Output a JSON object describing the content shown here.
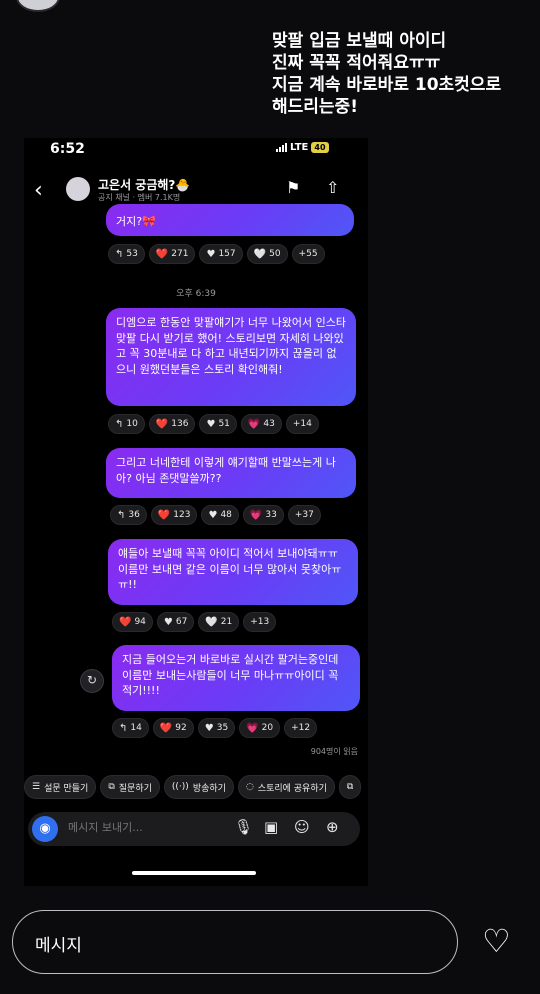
{
  "caption": {
    "lines": [
      "맞팔 입금 보낼때 아이디",
      "진짜 꼭꼭 적어줘요ㅠㅠ",
      "지금 계속 바로바로 10초컷으로",
      "해드리는중!"
    ]
  },
  "status": {
    "time": "6:52",
    "network": "LTE",
    "battery": "40"
  },
  "channel": {
    "title": "고은서 궁금해?🐣",
    "subtitle": "공지 채널 · 멤버 7.1K명"
  },
  "messages": [
    {
      "text": "거지?🎀",
      "reactions": [
        {
          "icon": "↰",
          "count": "53"
        },
        {
          "icon": "❤️",
          "count": "271"
        },
        {
          "icon": "♥",
          "count": "157"
        },
        {
          "icon": "🤍",
          "count": "50"
        },
        {
          "icon": "",
          "count": "+55"
        }
      ]
    },
    {
      "text": "디엠으로 한동안 맞팔얘기가 너무 나왔어서 인스타 맞팔 다시 받기로 했어! 스토리보면 자세히 나와있고 꼭 30분내로 다 하고 내년되기까지 끊을리 없으니 원했던분들은 스토리 확인해줘!",
      "reactions": [
        {
          "icon": "↰",
          "count": "10"
        },
        {
          "icon": "❤️",
          "count": "136"
        },
        {
          "icon": "♥",
          "count": "51"
        },
        {
          "icon": "💗",
          "count": "43"
        },
        {
          "icon": "",
          "count": "+14"
        }
      ]
    },
    {
      "text": "그리고 너네한테 이렇게 얘기할때 반말쓰는게 나아? 아님 존댓말쓸까??",
      "reactions": [
        {
          "icon": "↰",
          "count": "36"
        },
        {
          "icon": "❤️",
          "count": "123"
        },
        {
          "icon": "♥",
          "count": "48"
        },
        {
          "icon": "💗",
          "count": "33"
        },
        {
          "icon": "",
          "count": "+37"
        }
      ]
    },
    {
      "text": "얘들아 보낼때 꼭꼭 아이디 적어서 보내야돼ㅠㅠ 이름만 보내면 같은 이름이 너무 많아서 못찾아ㅠㅠ!!",
      "reactions": [
        {
          "icon": "❤️",
          "count": "94"
        },
        {
          "icon": "♥",
          "count": "67"
        },
        {
          "icon": "🤍",
          "count": "21"
        },
        {
          "icon": "",
          "count": "+13"
        }
      ]
    },
    {
      "text": "지금 들어오는거 바로바로 실시간 팔거는중인데 이름만 보내는사람들이 너무 마나ㅠㅠ아이디 꼭 적기!!!!",
      "reactions": [
        {
          "icon": "↰",
          "count": "14"
        },
        {
          "icon": "❤️",
          "count": "92"
        },
        {
          "icon": "♥",
          "count": "35"
        },
        {
          "icon": "💗",
          "count": "20"
        },
        {
          "icon": "",
          "count": "+12"
        }
      ]
    }
  ],
  "time_separator": "오후 6:39",
  "read_count": "904명이 읽음",
  "toolbar": [
    {
      "icon": "☰",
      "label": "설문 만들기"
    },
    {
      "icon": "⧉",
      "label": "질문하기"
    },
    {
      "icon": "((·))",
      "label": "방송하기"
    },
    {
      "icon": "◌",
      "label": "스토리에 공유하기"
    }
  ],
  "composer": {
    "placeholder": "메시지 보내기..."
  },
  "story_reply": {
    "placeholder": "메시지"
  }
}
